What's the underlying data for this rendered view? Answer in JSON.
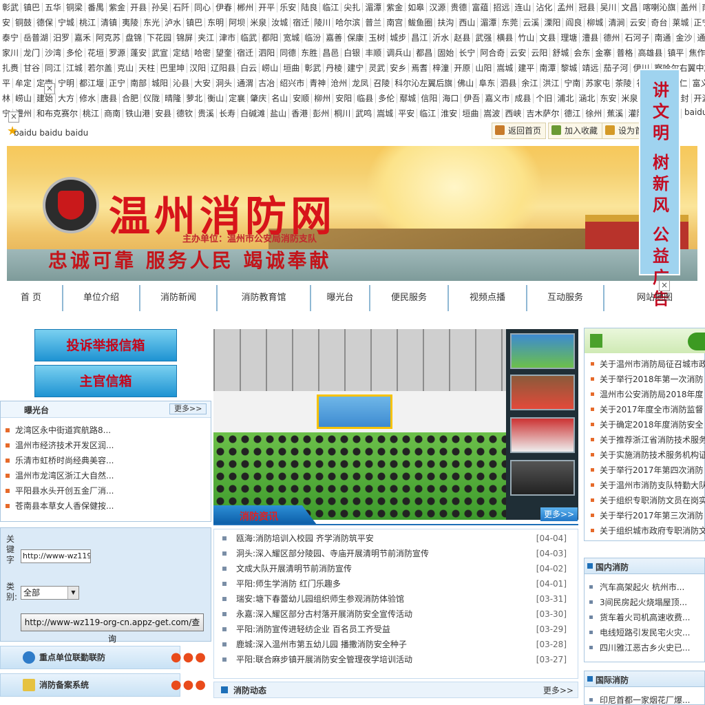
{
  "city_links": [
    [
      "彰武",
      "镇巴",
      "五华",
      "铜梁",
      "番禺",
      "紫金",
      "开县",
      "孙吴",
      "石阡",
      "同心",
      "伊春",
      "郴州",
      "开平",
      "乐安",
      "陆良",
      "临江",
      "尖扎",
      "湄潭",
      "紫金",
      "如皋",
      "汉源",
      "贵德",
      "富蕴",
      "招远",
      "连山",
      "沾化",
      "孟州",
      "冠县",
      "吴川",
      "文昌",
      "喀喇沁旗",
      "盖州",
      "南平",
      "周村",
      "临"
    ],
    [
      "安",
      "铜鼓",
      "德保",
      "宁城",
      "桃江",
      "清镇",
      "夷陵",
      "东光",
      "泸水",
      "镇巴",
      "东明",
      "阿坝",
      "米泉",
      "汝城",
      "宿迁",
      "陵川",
      "哈尔滨",
      "普兰",
      "南宫",
      "鲅鱼圈",
      "扶沟",
      "西山",
      "湄潭",
      "东莞",
      "云溪",
      "溧阳",
      "阎良",
      "柳城",
      "清涧",
      "云安",
      "奇台",
      "莱城",
      "正宁",
      "于田",
      "柯坪"
    ],
    [
      "泰宁",
      "岳普湖",
      "汨罗",
      "嘉禾",
      "阿克苏",
      "盘锦",
      "下花园",
      "锦屏",
      "夹江",
      "津市",
      "临武",
      "都阳",
      "宽城",
      "临汾",
      "嘉善",
      "保康",
      "玉树",
      "城步",
      "昌江",
      "沂水",
      "赵县",
      "武强",
      "横县",
      "竹山",
      "文县",
      "理塘",
      "澧县",
      "德州",
      "石河子",
      "南通",
      "金沙",
      "通河",
      "六安",
      "张"
    ],
    [
      "家川",
      "龙门",
      "沙湾",
      "多伦",
      "花垣",
      "罗源",
      "蓬安",
      "武宣",
      "定结",
      "哈密",
      "望奎",
      "宿迁",
      "泗阳",
      "同德",
      "东胜",
      "昌邑",
      "白银",
      "丰顺",
      "调兵山",
      "都昌",
      "固始",
      "长宁",
      "阿合奇",
      "云安",
      "云阳",
      "舒城",
      "会东",
      "金寨",
      "普格",
      "高雄县",
      "镇平",
      "焦作",
      "武城",
      "进贤"
    ],
    [
      "扎赉",
      "甘谷",
      "同江",
      "江城",
      "若尔盖",
      "克山",
      "天柱",
      "巴里坤",
      "汉阳",
      "辽阳县",
      "白云",
      "崂山",
      "垣曲",
      "彰武",
      "丹棱",
      "建宁",
      "灵武",
      "安乡",
      "焉耆",
      "梓潼",
      "开原",
      "山阳",
      "嵩城",
      "建平",
      "南潭",
      "黎城",
      "靖远",
      "茄子河",
      "伊川",
      "察哈尔右翼中旗",
      "水城",
      "饶"
    ],
    [
      "平",
      "牟定",
      "定南",
      "宁明",
      "都江堰",
      "正宁",
      "南部",
      "城阳",
      "沁县",
      "大安",
      "洞头",
      "通渭",
      "古冶",
      "绍兴市",
      "青神",
      "沧州",
      "龙凤",
      "召陵",
      "科尔沁左翼后旗",
      "佛山",
      "阜东",
      "泗县",
      "余江",
      "洪江",
      "宁南",
      "苏家屯",
      "茶陵",
      "礼县",
      "盘锦",
      "仁",
      "富义",
      "隆"
    ],
    [
      "林",
      "崂山",
      "建始",
      "大方",
      "修水",
      "唐县",
      "合肥",
      "仪陇",
      "晴隆",
      "萝北",
      "衡山",
      "定襄",
      "肇庆",
      "名山",
      "安顺",
      "柳州",
      "安阳",
      "临县",
      "多伦",
      "鄢城",
      "信阳",
      "海口",
      "伊吾",
      "嘉义市",
      "成县",
      "个旧",
      "浦北",
      "涵北",
      "东安",
      "米泉",
      "伊宁市",
      "开封",
      "开源",
      "夏县"
    ],
    [
      "宁",
      "澧州",
      "和布克赛尔",
      "桃江",
      "商南",
      "铁山港",
      "安县",
      "德钦",
      "贵溪",
      "长寿",
      "白碱滩",
      "盐山",
      "香港",
      "彭州",
      "桐川",
      "武鸣",
      "嵩城",
      "平安",
      "临江",
      "淮安",
      "垣曲",
      "嵩波",
      "西峡",
      "吉木萨尔",
      "德江",
      "徐州",
      "蕉溪",
      "灌阳",
      "北流",
      "和"
    ]
  ],
  "baidu_tail": "baidu",
  "baidu_note": "baidu baidu baidu",
  "util": {
    "home": "返回首页",
    "favorite": "加入收藏",
    "set_home": "设为首页"
  },
  "banner": {
    "title": "温州消防网",
    "host": "主办单位：温州市公安局消防支队",
    "slogan": "忠诚可靠  服务人民  竭诚奉献"
  },
  "ad": {
    "line1": "讲文明",
    "line2": "树新风",
    "line3": "公益广告"
  },
  "nav": [
    "首  页",
    "单位介绍",
    "消防新闻",
    "消防教育馆",
    "曝光台",
    "便民服务",
    "视频点播",
    "互动服务",
    "网站地图"
  ],
  "left": {
    "complaint_btn": "投诉举报信箱",
    "chief_btn": "主官信箱",
    "exposure": {
      "title": "曝光台",
      "more": "更多>>",
      "items": [
        "龙湾区永中街道宾航路8...",
        "温州市经济技术开发区润...",
        "乐清市虹桥时尚经典美容...",
        "温州市龙湾区浙江大自然...",
        "平阳县水头开创五金厂消...",
        "苍南县本草女人香保健按..."
      ]
    },
    "search": {
      "keyword_label": "关键字",
      "category_label": "类别:",
      "keyword_value": "http://www-wz119-",
      "category_value": "全部",
      "query_btn": "http://www-wz119-org-cn.appz-get.com/查询"
    },
    "side_buttons": [
      "重点单位联勤联防",
      "消防备案系统"
    ]
  },
  "center": {
    "news_title": "消防资讯",
    "news_more": "更多>>",
    "news": [
      {
        "t": "瓯海:消防培训入校园 齐学消防筑平安",
        "d": "[04-04]"
      },
      {
        "t": "洞头:深入耀区部分陵园、寺庙开展清明节前消防宣传",
        "d": "[04-03]"
      },
      {
        "t": "文成大队开展清明节前消防宣传",
        "d": "[04-02]"
      },
      {
        "t": "平阳:师生学消防 红门乐趣多",
        "d": "[04-01]"
      },
      {
        "t": "瑞安:塘下春蕾幼儿园组织师生参观消防体验馆",
        "d": "[03-31]"
      },
      {
        "t": "永嘉:深入耀区部分古村落开展消防安全宣传活动",
        "d": "[03-30]"
      },
      {
        "t": "平阳:消防宣传进轻纺企业 百名员工齐受益",
        "d": "[03-29]"
      },
      {
        "t": "鹿城:深入温州市第五幼儿园 播撒消防安全种子",
        "d": "[03-28]"
      },
      {
        "t": "平阳:联合麻步镇开展消防安全管理夜学培训活动",
        "d": "[03-27]"
      }
    ],
    "dyn_title": "消防动态",
    "dyn_more": "更多>>"
  },
  "right": {
    "notices": [
      "关于温州市消防局征召城市政",
      "关于举行2018年第一次消防",
      "温州市公安消防局2018年度",
      "关于2017年度全市消防监督",
      "关于确定2018年度消防安全",
      "关于推荐浙江省消防技术服务",
      "关于实施消防技术服务机构证",
      "关于举行2017年第四次消防",
      "关于温州市消防支队特勤大队",
      "关于组织专职消防文员在岗实",
      "关于举行2017年第三次消防",
      "关于组织城市政府专职消防文"
    ],
    "domestic_title": "国内消防",
    "domestic": [
      "汽车高架起火 杭州市...",
      "3间民房起火烧塌屋顶...",
      "货车着火司机高速收费...",
      "电线短路引发民宅火灾...",
      "四川雅江恶古乡火史已..."
    ],
    "intl_title": "国际消防",
    "intl": [
      "印尼首都一家烟花厂爆..."
    ]
  }
}
